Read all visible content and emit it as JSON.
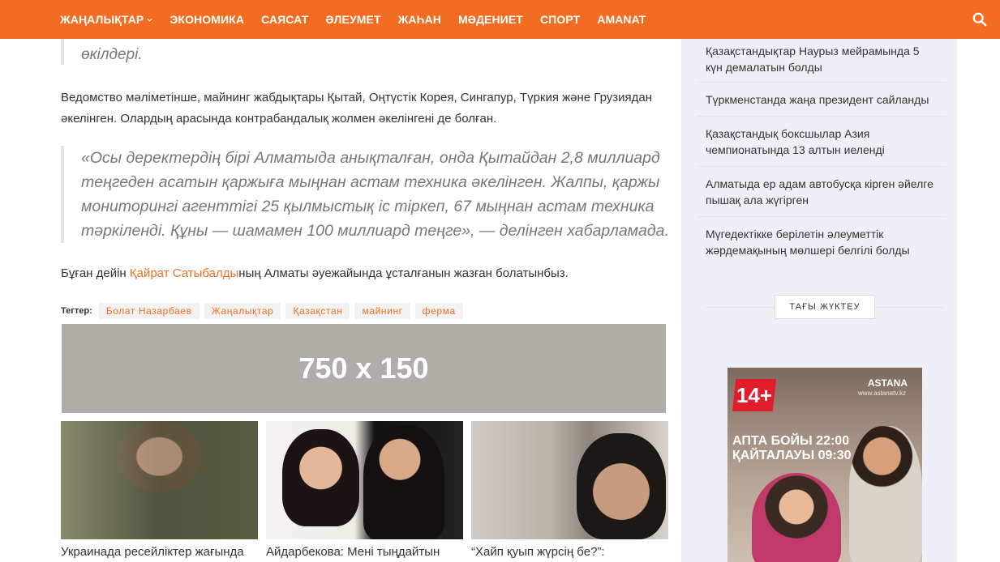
{
  "nav": {
    "items": [
      "ЖАҢАЛЫҚТАР",
      "ЭКОНОМИКА",
      "САЯСАТ",
      "ӘЛЕУМЕТ",
      "ЖАҺАН",
      "МӘДЕНИЕТ",
      "СПОРТ",
      "AMANAT"
    ],
    "search_icon": "search-icon"
  },
  "article": {
    "quote_top": "өкілдері.",
    "para1": "Ведомство мәліметінше, майнинг жабдықтары Қытай, Оңтүстік Корея, Сингапур, Түркия және Грузиядан әкелінген. Олардың арасында контрабандалық жолмен әкелінгені де болған.",
    "quote_main": "«Осы деректердің бірі Алматыда анықталған, онда Қытайдан 2,8 миллиард теңгеден асатын қаржыға мыңнан астам техника әкелінген. Жалпы, қаржы мониторингі агенттігі 25 қылмыстық іс тіркеп, 67 мыңнан астам техника тәркіленді. Құны — шамамен 100 миллиард теңге», — делінген хабарламада.",
    "para2_before": "Бұған дейін ",
    "para2_link": "Қайрат Сатыбалды",
    "para2_after": "ның Алматы әуежайында ұсталғанын жазған болатынбыз."
  },
  "tags": {
    "label": "Тегтер:",
    "items": [
      "Болат Назарбаев",
      "Жаңалықтар",
      "Қазақстан",
      "майнинг",
      "ферма"
    ]
  },
  "banner": {
    "text": "750 x 150"
  },
  "related": [
    {
      "title": "Украинада ресейліктер жағында"
    },
    {
      "title": "Айдарбекова: Мені тыңдайтын"
    },
    {
      "title": "“Хайп қуып жүрсің бе?”:"
    }
  ],
  "sidebar": {
    "items": [
      "Қазақстандықтар Наурыз мейрамында 5 күн демалатын болды",
      "Түркменстанда жаңа президент сайланды",
      "Қазақстандық боксшылар Азия чемпионатында 13 алтын иеленді",
      "Алматыда ер адам автобусқа кірген әйелге пышақ ала жүгірген",
      "Мүгедектікке берілетін әлеуметтік жәрдемақының мөлшері белгілі болды"
    ],
    "load_more": "ТАҒЫ ЖҮКТЕУ",
    "ad": {
      "age": "14+",
      "brand": "ASTANA",
      "brand_sub": "www.astanatv.kz",
      "line1": "АПТА БОЙЫ 22:00",
      "line2": "ҚАЙТАЛАУЫ 09:30"
    }
  },
  "colors": {
    "accent": "#f26d21",
    "sidebar_bg": "#eef0f7",
    "text": "#333333",
    "quote": "#777777"
  }
}
